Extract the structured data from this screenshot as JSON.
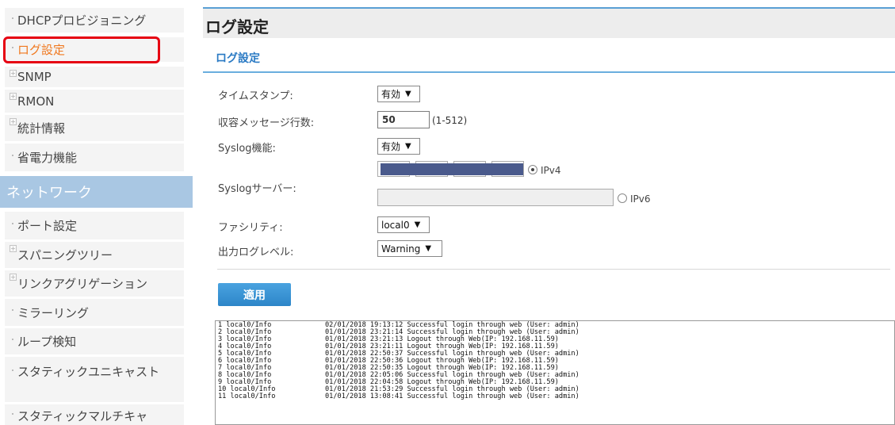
{
  "sidebar": {
    "items": [
      {
        "label": "DHCPプロビジョニング",
        "type": "bullet"
      },
      {
        "label": "ログ設定",
        "type": "bullet",
        "active": true
      },
      {
        "label": "SNMP",
        "type": "plus"
      },
      {
        "label": "RMON",
        "type": "plus"
      },
      {
        "label": "統計情報",
        "type": "plus"
      },
      {
        "label": "省電力機能",
        "type": "bullet"
      }
    ],
    "section_header": "ネットワーク",
    "network_items": [
      {
        "label": "ポート設定",
        "type": "bullet"
      },
      {
        "label": "スパニングツリー",
        "type": "plus"
      },
      {
        "label": "リンクアグリゲーション",
        "type": "plus"
      },
      {
        "label": "ミラーリング",
        "type": "bullet"
      },
      {
        "label": "ループ検知",
        "type": "bullet"
      },
      {
        "label": "スタティックユニキャスト",
        "type": "bullet"
      },
      {
        "label": "スタティックマルチキャ",
        "type": "bullet"
      }
    ]
  },
  "page": {
    "title": "ログ設定",
    "section_title": "ログ設定"
  },
  "form": {
    "timestamp_label": "タイムスタンプ:",
    "timestamp_value": "有効",
    "max_messages_label": "収容メッセージ行数:",
    "max_messages_value": "50",
    "max_messages_range": "(1-512)",
    "syslog_label": "Syslog機能:",
    "syslog_value": "有効",
    "syslog_server_label": "Syslogサーバー:",
    "ipv4_label": "IPv4",
    "ipv6_label": "IPv6",
    "facility_label": "ファシリティ:",
    "facility_value": "local0",
    "log_level_label": "出力ログレベル:",
    "log_level_value": "Warning",
    "apply_label": "適用"
  },
  "log_lines": [
    {
      "n": "1",
      "src": "local0/Info",
      "msg": "02/01/2018 19:13:12 Successful login through web (User: admin)"
    },
    {
      "n": "2",
      "src": "local0/Info",
      "msg": "01/01/2018 23:21:14 Successful login through web (User: admin)"
    },
    {
      "n": "3",
      "src": "local0/Info",
      "msg": "01/01/2018 23:21:13 Logout through Web(IP: 192.168.11.59)"
    },
    {
      "n": "4",
      "src": "local0/Info",
      "msg": "01/01/2018 23:21:11 Logout through Web(IP: 192.168.11.59)"
    },
    {
      "n": "5",
      "src": "local0/Info",
      "msg": "01/01/2018 22:50:37 Successful login through web (User: admin)"
    },
    {
      "n": "6",
      "src": "local0/Info",
      "msg": "01/01/2018 22:50:36 Logout through Web(IP: 192.168.11.59)"
    },
    {
      "n": "7",
      "src": "local0/Info",
      "msg": "01/01/2018 22:50:35 Logout through Web(IP: 192.168.11.59)"
    },
    {
      "n": "8",
      "src": "local0/Info",
      "msg": "01/01/2018 22:05:06 Successful login through web (User: admin)"
    },
    {
      "n": "9",
      "src": "local0/Info",
      "msg": "01/01/2018 22:04:58 Logout through Web(IP: 192.168.11.59)"
    },
    {
      "n": "10",
      "src": "local0/Info",
      "msg": "01/01/2018 21:53:29 Successful login through web (User: admin)"
    },
    {
      "n": "11",
      "src": "local0/Info",
      "msg": "01/01/2018 13:08:41 Successful login through web (User: admin)"
    }
  ]
}
